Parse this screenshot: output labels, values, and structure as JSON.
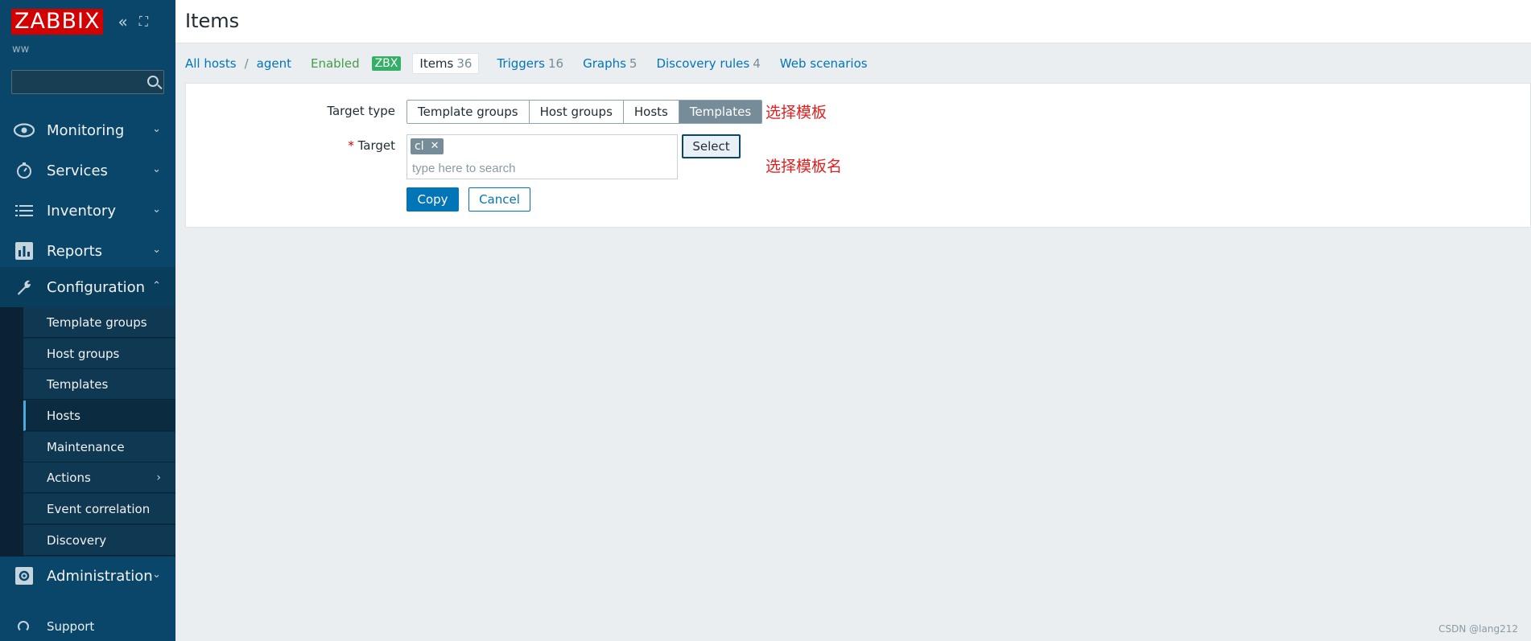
{
  "brand": {
    "logo": "ZABBIX",
    "server_name": "ww"
  },
  "sidebar": {
    "search_placeholder": "",
    "menu": [
      {
        "label": "Monitoring",
        "icon": "eye-icon"
      },
      {
        "label": "Services",
        "icon": "stopwatch-icon"
      },
      {
        "label": "Inventory",
        "icon": "list-icon"
      },
      {
        "label": "Reports",
        "icon": "bar-chart-icon"
      },
      {
        "label": "Configuration",
        "icon": "wrench-icon"
      },
      {
        "label": "Administration",
        "icon": "gear-icon"
      }
    ],
    "submenu": [
      {
        "label": "Template groups"
      },
      {
        "label": "Host groups"
      },
      {
        "label": "Templates"
      },
      {
        "label": "Hosts"
      },
      {
        "label": "Maintenance"
      },
      {
        "label": "Actions"
      },
      {
        "label": "Event correlation"
      },
      {
        "label": "Discovery"
      }
    ],
    "support": "Support"
  },
  "header": {
    "title": "Items"
  },
  "breadcrumb": {
    "all_hosts": "All hosts",
    "separator": "/",
    "host": "agent",
    "status": "Enabled",
    "availability": "ZBX",
    "tabs": [
      {
        "label": "Items",
        "count": "36"
      },
      {
        "label": "Triggers",
        "count": "16"
      },
      {
        "label": "Graphs",
        "count": "5"
      },
      {
        "label": "Discovery rules",
        "count": "4"
      },
      {
        "label": "Web scenarios",
        "count": ""
      }
    ]
  },
  "form": {
    "target_type_label": "Target type",
    "target_types": [
      "Template groups",
      "Host groups",
      "Hosts",
      "Templates"
    ],
    "target_label": "Target",
    "required_mark": "*",
    "target_chip": "cl",
    "search_placeholder": "type here to search",
    "select_label": "Select",
    "copy_label": "Copy",
    "cancel_label": "Cancel"
  },
  "annotations": {
    "type_note": "选择模板",
    "target_note": "选择模板名"
  },
  "watermark": "CSDN @lang212",
  "colors": {
    "sidebar": "#0a466a",
    "logo": "#d40000",
    "link": "#0275b8",
    "enabled": "#429e47",
    "zbx_badge": "#34af67",
    "annotation": "#e21f1f"
  }
}
